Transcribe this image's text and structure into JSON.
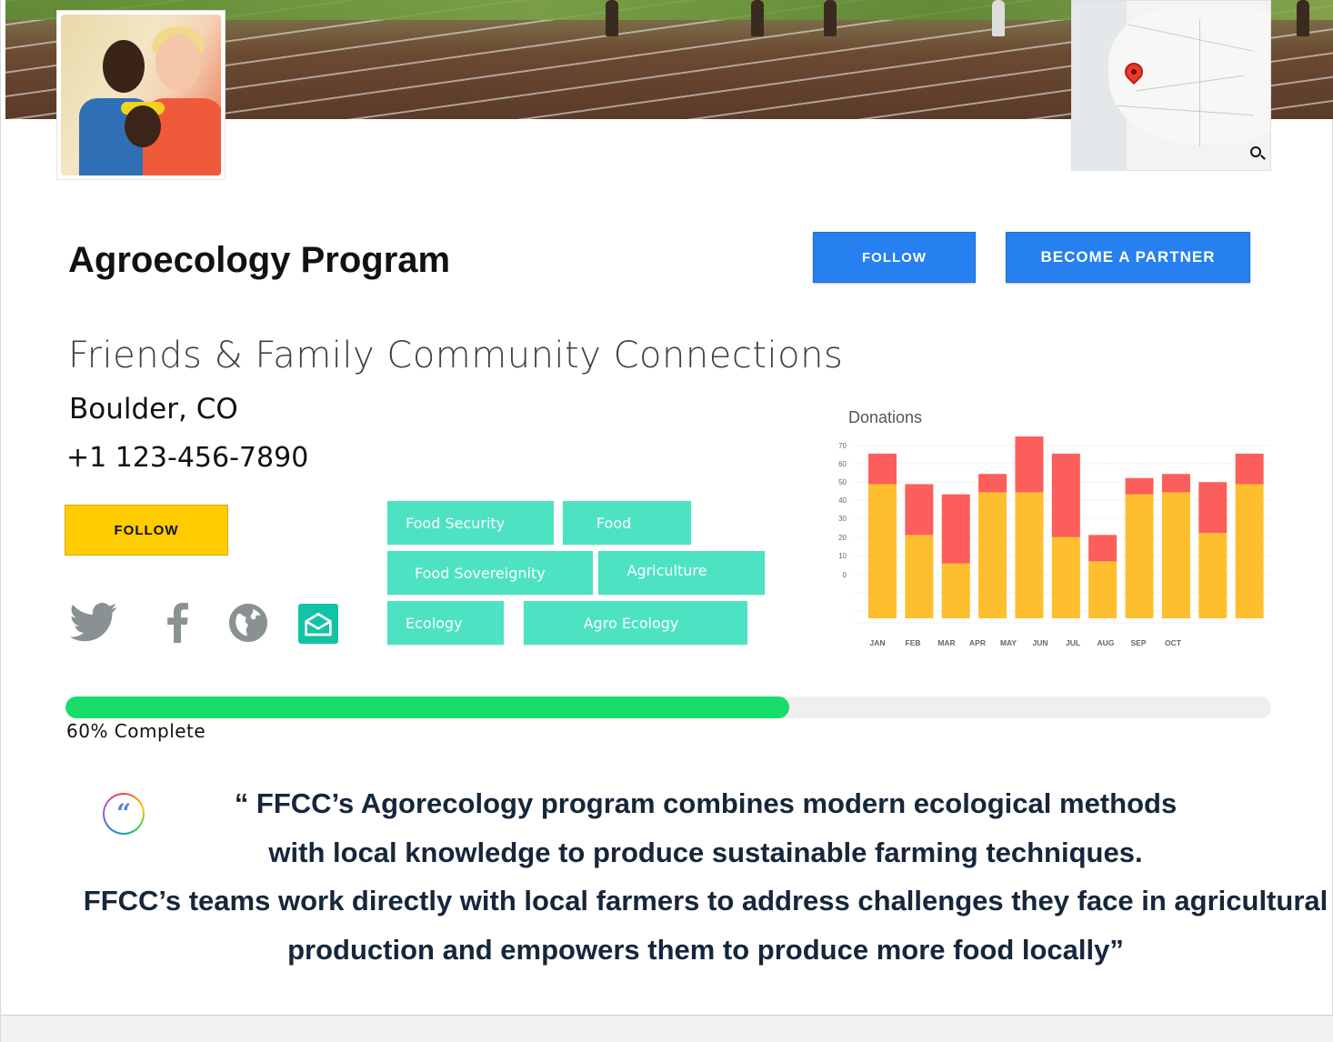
{
  "header": {
    "banner_alt": "",
    "map_search_icon": "search-icon"
  },
  "profile": {
    "title": "Agroecology Program",
    "organization": "Friends & Family Community  Connections",
    "location": "Boulder, CO",
    "phone": "+1 123-456-7890"
  },
  "actions": {
    "follow_top_label": "FOLLOW",
    "partner_label": "BECOME A PARTNER",
    "follow_yellow_label": "FOLLOW"
  },
  "social": {
    "icons": [
      "twitter-icon",
      "facebook-icon",
      "globe-icon",
      "mail-icon"
    ]
  },
  "tags": {
    "food_security": "Food Security",
    "food": "Food",
    "food_sovereignty": "Food Sovereignity",
    "agriculture": "Agriculture",
    "ecology": "Ecology",
    "agro_ecology": "Agro Ecology"
  },
  "chart_data": {
    "type": "bar",
    "title": "Donations",
    "y_ticks": [
      "70",
      "60",
      "50",
      "40",
      "30",
      "20",
      "10",
      "0"
    ],
    "categories": [
      "JAN",
      "FEB",
      "MAR",
      "APR",
      "MAY",
      "JUN",
      "JUL",
      "AUG",
      "SEP",
      "OCT",
      "",
      ""
    ],
    "series": [
      {
        "color": "#fdbf2d",
        "values": [
          66,
          41,
          27,
          62,
          62,
          40,
          28,
          61,
          62,
          42,
          66,
          66
        ]
      },
      {
        "color": "#fb5e5b",
        "values": [
          15,
          25,
          34,
          9,
          47,
          41,
          13,
          8,
          9,
          25,
          15,
          15
        ]
      }
    ],
    "bar_count": 11,
    "grid": true
  },
  "progress": {
    "percent": 60,
    "label": "60% Complete",
    "fill_color": "#18dd6a"
  },
  "quote": {
    "icon": "quote-icon",
    "icon_glyph": "“",
    "lines": [
      "“ FFCC’s Agorecology program combines modern ecological methods",
      "with local knowledge to produce sustainable farming techniques.",
      "FFCC’s teams work directly with local farmers to address challenges they face in agricultural",
      "production and empowers them to produce more food locally”"
    ]
  }
}
